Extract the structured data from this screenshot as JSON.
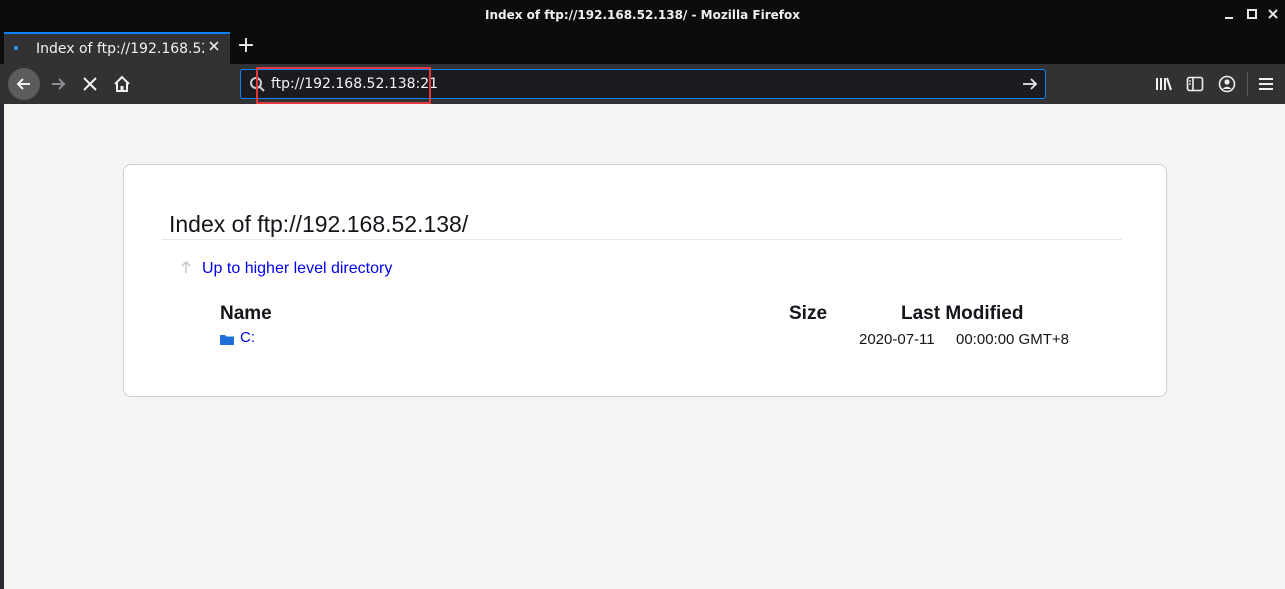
{
  "window": {
    "title": "Index of ftp://192.168.52.138/ - Mozilla Firefox"
  },
  "tab": {
    "title": "Index of ftp://192.168.52.138/",
    "new_tab_label": "+"
  },
  "urlbar": {
    "value": "ftp://192.168.52.138:21"
  },
  "page": {
    "heading": "Index of ftp://192.168.52.138/",
    "up_link": "Up to higher level directory",
    "columns": {
      "name": "Name",
      "size": "Size",
      "modified": "Last Modified"
    },
    "rows": [
      {
        "name": "C:",
        "size": "",
        "date": "2020-07-11",
        "time": "00:00:00 GMT+8"
      }
    ]
  },
  "colors": {
    "accent": "#0a84ff",
    "link": "#0000ee",
    "highlight_box": "#e03a3a"
  }
}
